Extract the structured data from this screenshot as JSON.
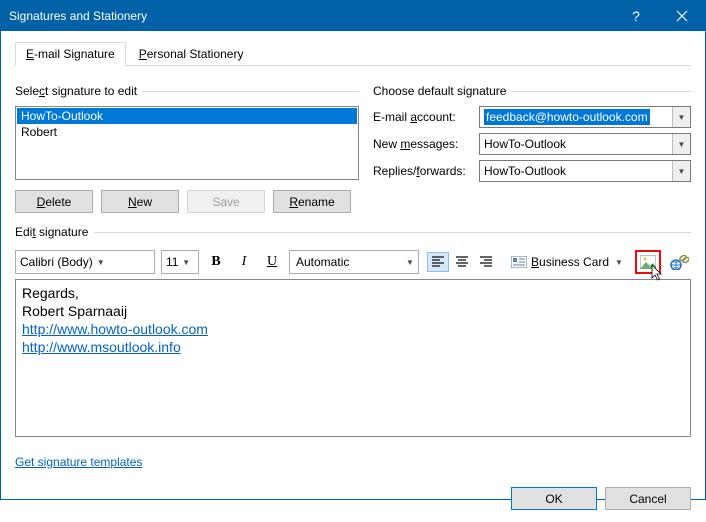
{
  "window": {
    "title": "Signatures and Stationery"
  },
  "tabs": {
    "email_signature": "E-mail Signature",
    "personal_stationery": "Personal Stationery"
  },
  "select_section": {
    "legend": "Select signature to edit",
    "items": [
      "HowTo-Outlook",
      "Robert"
    ],
    "buttons": {
      "delete": "Delete",
      "new": "New",
      "save": "Save",
      "rename": "Rename"
    }
  },
  "default_section": {
    "legend": "Choose default signature",
    "account_label": "E-mail account:",
    "account_value": "feedback@howto-outlook.com",
    "newmsg_label": "New messages:",
    "newmsg_value": "HowTo-Outlook",
    "replies_label": "Replies/forwards:",
    "replies_value": "HowTo-Outlook"
  },
  "edit_section": {
    "legend": "Edit signature",
    "font": "Calibri (Body)",
    "size": "11",
    "color": "Automatic",
    "bizcard": "Business Card",
    "body": {
      "line1": "Regards,",
      "line2": "Robert Sparnaaij",
      "link1": "http://www.howto-outlook.com",
      "link2": "http://www.msoutlook.info"
    }
  },
  "templates_link": "Get signature templates",
  "footer": {
    "ok": "OK",
    "cancel": "Cancel"
  }
}
